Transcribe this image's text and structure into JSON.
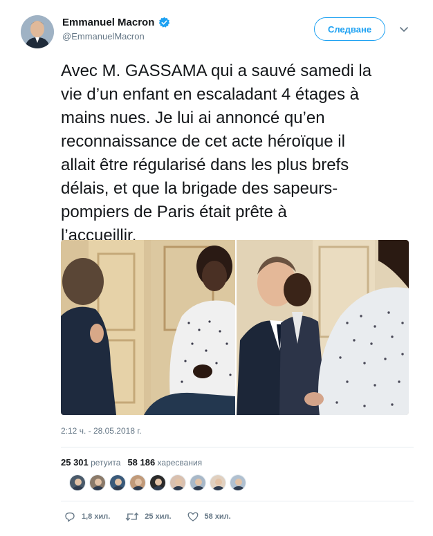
{
  "author": {
    "display_name": "Emmanuel Macron",
    "handle": "@EmmanuelMacron",
    "verified": true
  },
  "follow_button": {
    "label": "Следване"
  },
  "tweet": {
    "text": "Avec M. GASSAMA qui a sauvé samedi la\nvie d’un enfant en escaladant 4 étages à\nmains nues. Je lui ai annoncé qu’en\nreconnaissance de cet acte héroïque il\nallait être régularisé dans les plus brefs\ndélais, et que la brigade des sapeurs-\npompiers de Paris était prête à\nl’accueillir.",
    "timestamp": "2:12 ч. - 28.05.2018 г."
  },
  "media": {
    "photo_count": 2
  },
  "stats": {
    "retweets_count": "25 301",
    "retweets_label": "ретуита",
    "likes_count": "58 186",
    "likes_label": "харесвания"
  },
  "liker_avatars": [
    {
      "color": "#4a5a6a"
    },
    {
      "color": "#8a7a6a"
    },
    {
      "color": "#3a5a7a"
    },
    {
      "color": "#c09a7a"
    },
    {
      "color": "#2a2a2a"
    },
    {
      "color": "#d8c0b0"
    },
    {
      "color": "#a8b8c8"
    },
    {
      "color": "#e0d0c0"
    },
    {
      "color": "#b0c0d0"
    }
  ],
  "actions": {
    "reply": "1,8 хил.",
    "retweet": "25 хил.",
    "like": "58 хил."
  },
  "colors": {
    "accent": "#1da1f2",
    "text": "#14171a",
    "muted": "#657786",
    "divider": "#e6ecf0"
  },
  "icons": {
    "verified": "verified-badge-icon",
    "caret": "chevron-down-icon",
    "reply": "reply-icon",
    "retweet": "retweet-icon",
    "like": "heart-icon"
  }
}
